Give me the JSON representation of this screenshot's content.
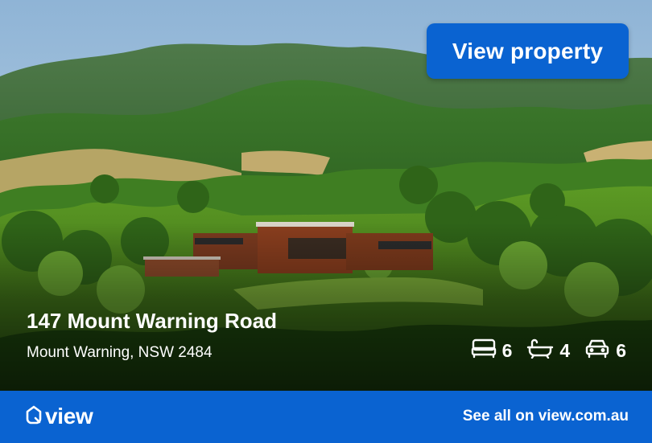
{
  "cta": {
    "label": "View property"
  },
  "listing": {
    "address": "147 Mount Warning Road",
    "suburb": "Mount Warning, NSW 2484",
    "features": {
      "bedrooms": "6",
      "bathrooms": "4",
      "car_spaces": "6"
    }
  },
  "footer": {
    "logo_text": "view",
    "link_label": "See all on view.com.au"
  },
  "colors": {
    "brand_blue": "#0a63d1",
    "text": "#ffffff"
  },
  "icons": [
    "bed-icon",
    "bath-icon",
    "car-icon",
    "view-logo-icon"
  ]
}
